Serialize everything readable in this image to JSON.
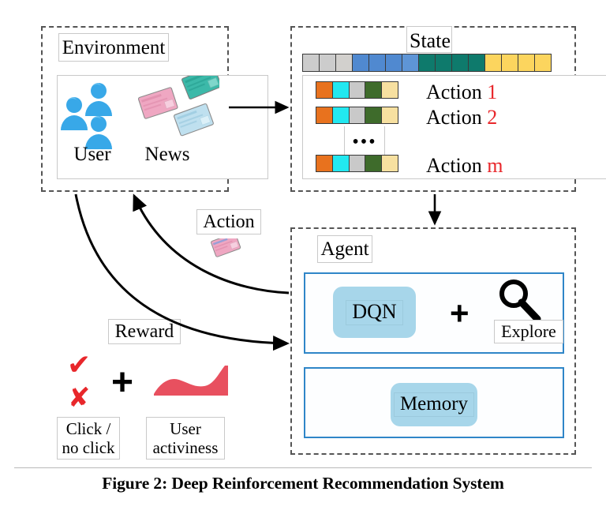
{
  "figure": {
    "caption": "Figure 2: Deep Reinforcement Recommendation System"
  },
  "environment": {
    "title": "Environment",
    "user_label": "User",
    "news_label": "News",
    "user_icon": "person-icon",
    "news_icon": "news-card-icon",
    "user_icon_color": "#38a8e8",
    "news_icon_colors": [
      "#3cb9a9",
      "#efa7c2",
      "#bfe0ef"
    ]
  },
  "state": {
    "title": "State",
    "cells": [
      {
        "color": "#cccccc"
      },
      {
        "color": "#cccccc"
      },
      {
        "color": "#d2d0cd"
      },
      {
        "color": "#5089d0"
      },
      {
        "color": "#5089d0"
      },
      {
        "color": "#5089d0"
      },
      {
        "color": "#5e95d6"
      },
      {
        "color": "#0e7a6c"
      },
      {
        "color": "#0e7a6c"
      },
      {
        "color": "#0e7a6c"
      },
      {
        "color": "#0e7a6c"
      },
      {
        "color": "#fcd55e"
      },
      {
        "color": "#fcd55e"
      },
      {
        "color": "#fcd55e"
      },
      {
        "color": "#fcd55e"
      }
    ]
  },
  "actions": {
    "cell_colors": [
      "#e8721e",
      "#22e8f0",
      "#c9c9c9",
      "#3e6b2b",
      "#f7e0a0"
    ],
    "ellipsis": "•••",
    "rows": [
      {
        "label": "Action ",
        "index": "1"
      },
      {
        "label": "Action ",
        "index": "2"
      },
      {
        "label": "Action ",
        "index": "m"
      }
    ]
  },
  "agent": {
    "title": "Agent",
    "dqn_label": "DQN",
    "plus_label": "+",
    "explore_label": "Explore",
    "explore_icon": "magnifier-icon",
    "memory_label": "Memory",
    "panel_border_color": "#2f86c8",
    "chip_color": "#a7d6ea"
  },
  "flows": {
    "action_label": "Action",
    "action_icon": "news-card-icon",
    "reward_label": "Reward"
  },
  "reward": {
    "check_glyph": "✔",
    "cross_glyph": "✘",
    "plus_glyph": "+",
    "click_label_line1": "Click /",
    "click_label_line2": "no click",
    "activiness_label_line1": "User",
    "activiness_label_line2": "activiness",
    "curve_icon": "activity-curve-icon",
    "curve_color": "#e8505f",
    "mark_color": "#e8272b"
  }
}
